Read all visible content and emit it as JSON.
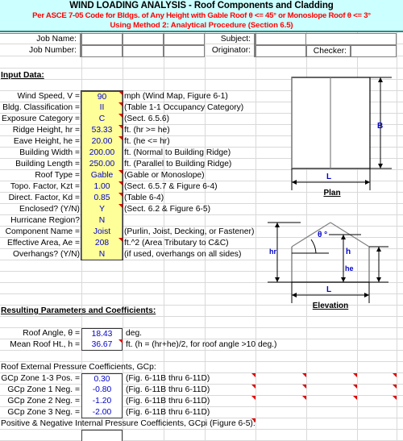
{
  "title": {
    "line1": "WIND LOADING ANALYSIS - Roof Components and Cladding",
    "line2": "Per ASCE 7-05 Code for Bldgs. of Any Height with Gable Roof θ <= 45° or Monoslope Roof θ <= 3°",
    "line3": "Using Method 2: Analytical Procedure (Section 6.5)",
    "bg_color": "#ccffff",
    "line1_color": "#000000",
    "line2_color": "#ff0000"
  },
  "jobheader": {
    "job_name_label": "Job Name:",
    "job_name_value": "",
    "subject_label": "Subject:",
    "subject_value": "",
    "job_number_label": "Job Number:",
    "job_number_value": "",
    "originator_label": "Originator:",
    "originator_value": "",
    "checker_label": "Checker:",
    "checker_value": ""
  },
  "input_section": {
    "heading": "Input Data:",
    "rows": [
      {
        "label": "Wind Speed, V =",
        "value": "90",
        "note": "mph  (Wind Map, Figure 6-1)",
        "comment": true
      },
      {
        "label": "Bldg. Classification =",
        "value": "II",
        "note": "(Table 1-1 Occupancy Category)",
        "comment": true
      },
      {
        "label": "Exposure Category =",
        "value": "C",
        "note": "(Sect. 6.5.6)",
        "comment": true
      },
      {
        "label": "Ridge Height, hr =",
        "value": "53.33",
        "note": "ft. (hr >= he)",
        "comment": true
      },
      {
        "label": "Eave Height, he =",
        "value": "20.00",
        "note": "ft. (he <= hr)",
        "comment": true
      },
      {
        "label": "Building Width =",
        "value": "200.00",
        "note": "ft. (Normal to Building Ridge)",
        "comment": false
      },
      {
        "label": "Building Length =",
        "value": "250.00",
        "note": "ft. (Parallel to Building Ridge)",
        "comment": false
      },
      {
        "label": "Roof Type =",
        "value": "Gable",
        "note": "(Gable or Monoslope)",
        "comment": true
      },
      {
        "label": "Topo. Factor, Kzt =",
        "value": "1.00",
        "note": "(Sect. 6.5.7 & Figure 6-4)",
        "comment": true
      },
      {
        "label": "Direct. Factor, Kd =",
        "value": "0.85",
        "note": "(Table 6-4)",
        "comment": true
      },
      {
        "label": "Enclosed? (Y/N)",
        "value": "Y",
        "note": "(Sect. 6.2 & Figure 6-5)",
        "comment": true
      },
      {
        "label": "Hurricane Region?",
        "value": "N",
        "note": "",
        "comment": false
      },
      {
        "label": "Component Name =",
        "value": "Joist",
        "note": "(Purlin, Joist, Decking, or Fastener)",
        "comment": false
      },
      {
        "label": "Effective Area, Ae =",
        "value": "208",
        "note": "ft.^2  (Area Tributary to C&C)",
        "comment": true
      },
      {
        "label": "Overhangs? (Y/N)",
        "value": "N",
        "note": "(if used, overhangs on all sides)",
        "comment": false
      }
    ]
  },
  "results_section": {
    "heading": "Resulting Parameters and Coefficients:",
    "rows": [
      {
        "label": "Roof Angle, θ =",
        "value": "18.43",
        "note": "deg.",
        "comment": false
      },
      {
        "label": "Mean Roof  Ht., h =",
        "value": "36.67",
        "note": "ft. (h = (hr+he)/2, for roof angle >10 deg.)",
        "comment": true
      }
    ]
  },
  "gcp_section": {
    "heading": "Roof External Pressure Coefficients, GCp:",
    "rows": [
      {
        "label": "GCp Zone 1-3 Pos. =",
        "value": "0.30",
        "note": "(Fig. 6-11B thru 6-11D)"
      },
      {
        "label": "GCp Zone 1 Neg. =",
        "value": "-0.80",
        "note": "(Fig. 6-11B thru 6-11D)"
      },
      {
        "label": "GCp Zone 2 Neg. =",
        "value": "-1.20",
        "note": "(Fig. 6-11B thru 6-11D)"
      },
      {
        "label": "GCp Zone 3 Neg. =",
        "value": "-2.00",
        "note": "(Fig. 6-11B thru 6-11D)"
      }
    ]
  },
  "gcpi_section": {
    "heading": "Positive & Negative Internal Pressure Coefficients, GCpi (Figure 6-5):"
  },
  "figures": {
    "plan": {
      "caption": "Plan",
      "dim_right": "B",
      "dim_bottom": "L"
    },
    "elevation": {
      "caption": "Elevation",
      "dim_left": "hr",
      "dim_center": "h",
      "dim_right": "he",
      "dim_bottom": "L",
      "angle_label": "θ °"
    }
  },
  "colors": {
    "input_fill": "#ffff99",
    "value_text": "#0000cc",
    "comment_marker": "#e00000",
    "gridline": "#d9d9d9"
  }
}
